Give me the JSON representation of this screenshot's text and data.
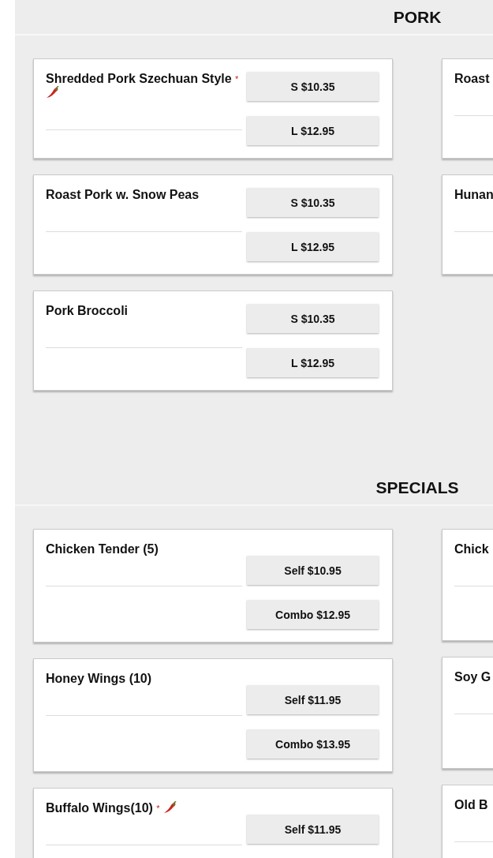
{
  "sections": [
    {
      "title": "PORK",
      "columns": [
        [
          {
            "name": "Shredded Pork Szechuan Style",
            "marker": "*",
            "spicy": true,
            "prices": [
              "S $10.35",
              "L $12.95"
            ]
          },
          {
            "name": "Roast Pork w. Snow Peas",
            "spicy": false,
            "prices": [
              "S $10.35",
              "L $12.95"
            ]
          },
          {
            "name": "Pork Broccoli",
            "spicy": false,
            "prices": [
              "S $10.35",
              "L $12.95"
            ]
          }
        ],
        [
          {
            "name": "Roast",
            "spicy": false
          },
          {
            "name": "Hunan",
            "spicy": false
          }
        ]
      ]
    },
    {
      "title": "SPECIALS",
      "columns": [
        [
          {
            "name": "Chicken Tender (5)",
            "spicy": false,
            "prices": [
              "Self $10.95",
              "Combo $12.95"
            ]
          },
          {
            "name": "Honey Wings (10)",
            "spicy": false,
            "prices": [
              "Self $11.95",
              "Combo $13.95"
            ]
          },
          {
            "name": "Buffalo Wings(10)",
            "marker": "*",
            "spicy": true,
            "prices": [
              "Self $11.95"
            ]
          }
        ],
        [
          {
            "name": "Chick",
            "spicy": false
          },
          {
            "name": "Soy G",
            "spicy": false
          },
          {
            "name": "Old B",
            "spicy": false
          }
        ]
      ]
    }
  ]
}
